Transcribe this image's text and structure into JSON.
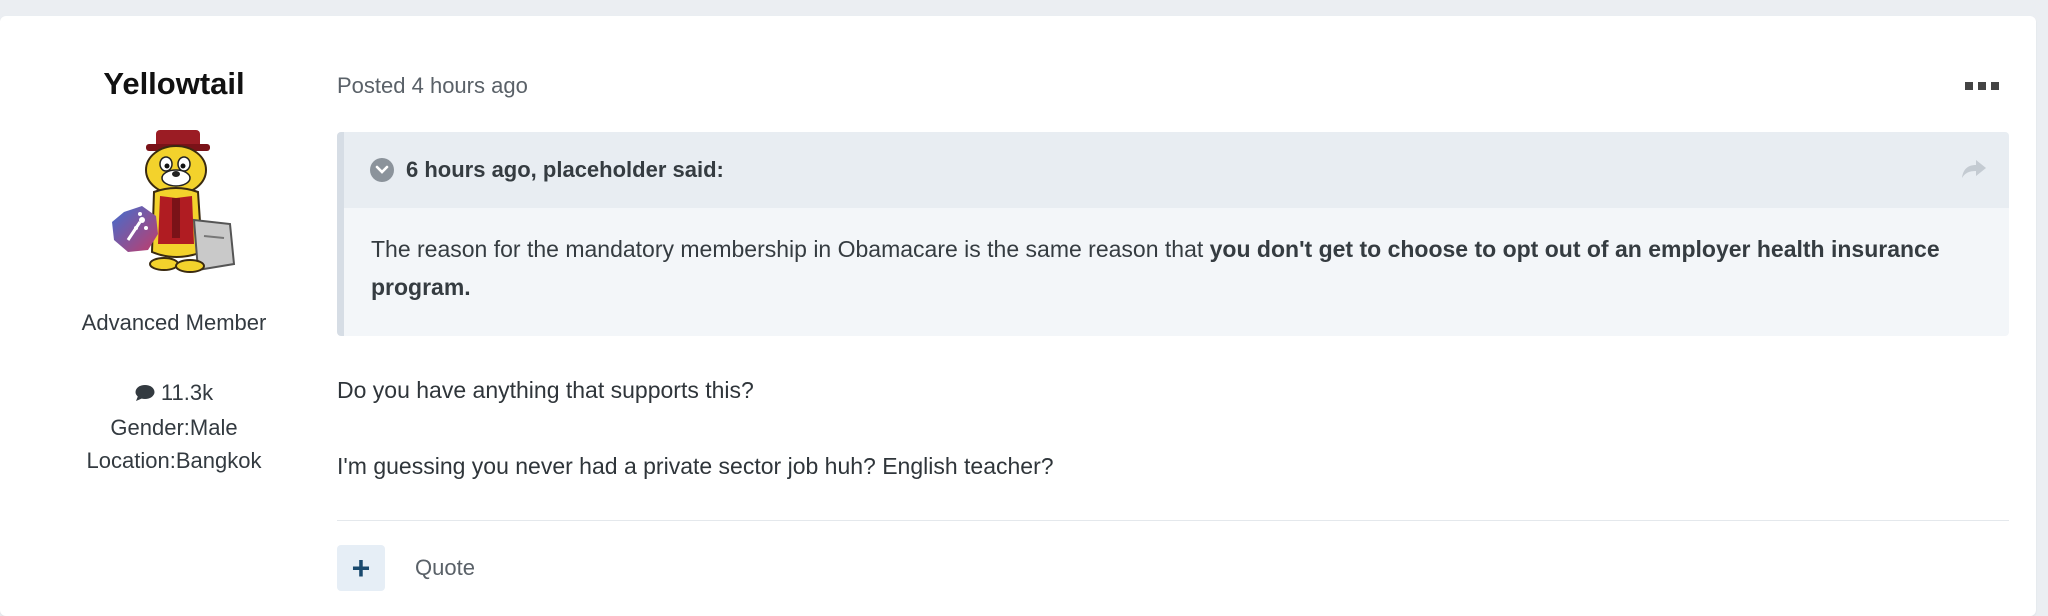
{
  "author": {
    "name": "Yellowtail",
    "title": "Advanced Member",
    "post_count": "11.3k",
    "gender": "Gender:Male",
    "location": "Location:Bangkok"
  },
  "post": {
    "posted": "Posted 4 hours ago",
    "quote": {
      "citation": "6 hours ago, placeholder said:",
      "text_plain": "The reason for the mandatory membership in Obamacare is the same reason that ",
      "text_bold": "you don't get to choose to opt out of an employer health insurance program."
    },
    "paragraphs": [
      "Do you have anything that supports this?",
      "I'm guessing you never had a private sector job huh? English teacher?"
    ],
    "actions": {
      "plus_label": "+",
      "quote_label": "Quote"
    }
  },
  "icons": {
    "more": "more-icon",
    "chevron": "chevron-down-icon",
    "share": "share-icon",
    "comment": "comment-icon"
  },
  "colors": {
    "quote_bg": "#f3f6f9",
    "quote_header_bg": "#e8edf2",
    "plus_bg": "#e6eef6",
    "plus_fg": "#1a4a6e"
  }
}
